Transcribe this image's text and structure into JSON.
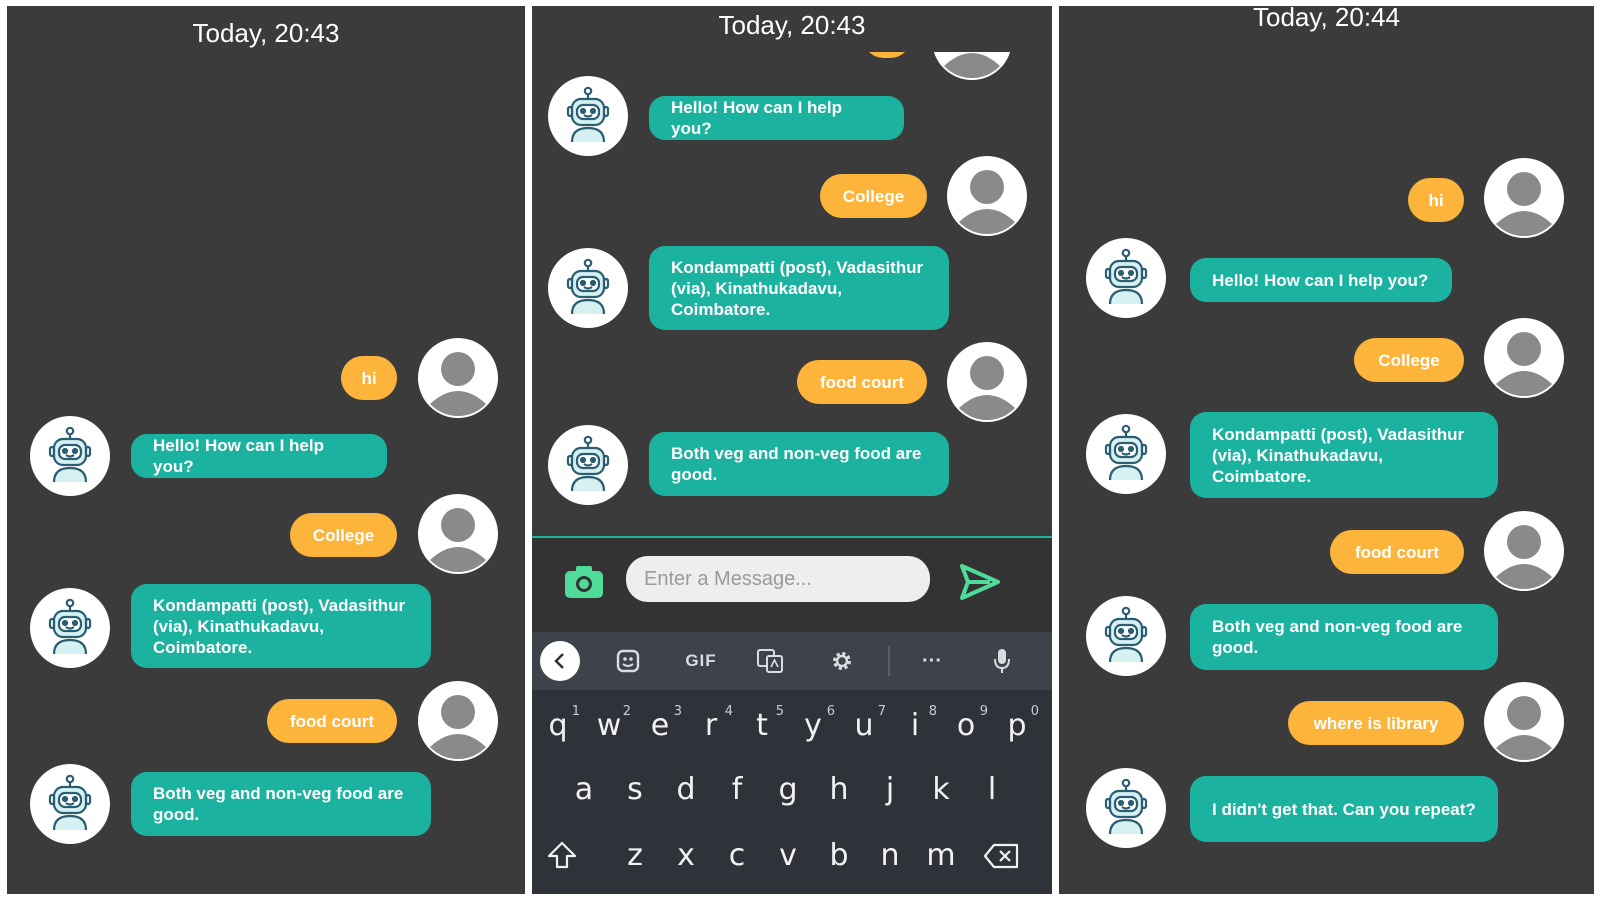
{
  "colors": {
    "panel_bg": "#3b3b3b",
    "bot_bubble": "#1bb3a0",
    "user_bubble": "#fcb43a",
    "accent": "#4fdc9a"
  },
  "icons": {
    "bot": "robot-avatar-icon",
    "user": "person-avatar-icon",
    "camera": "camera-icon",
    "send": "send-arrow-icon"
  },
  "panel1": {
    "time": "Today, 20:43",
    "messages": [
      {
        "from": "user",
        "text": "hi"
      },
      {
        "from": "bot",
        "text": "Hello! How can I help you?"
      },
      {
        "from": "user",
        "text": "College"
      },
      {
        "from": "bot",
        "text": "Kondampatti (post), Vadasithur (via), Kinathukadavu, Coimbatore."
      },
      {
        "from": "user",
        "text": "food court"
      },
      {
        "from": "bot",
        "text": "Both veg and non-veg food are good."
      }
    ]
  },
  "panel2": {
    "time": "Today, 20:43",
    "messages": [
      {
        "from": "bot",
        "text": "Hello! How can I help you?"
      },
      {
        "from": "user",
        "text": "College"
      },
      {
        "from": "bot",
        "text": "Kondampatti (post), Vadasithur (via), Kinathukadavu, Coimbatore."
      },
      {
        "from": "user",
        "text": "food court"
      },
      {
        "from": "bot",
        "text": "Both veg and non-veg food are good."
      }
    ],
    "input": {
      "placeholder": "Enter a Message..."
    },
    "keyboard": {
      "toolbar": {
        "gif": "GIF",
        "more": "···"
      },
      "row1": [
        {
          "k": "q",
          "n": "1"
        },
        {
          "k": "w",
          "n": "2"
        },
        {
          "k": "e",
          "n": "3"
        },
        {
          "k": "r",
          "n": "4"
        },
        {
          "k": "t",
          "n": "5"
        },
        {
          "k": "y",
          "n": "6"
        },
        {
          "k": "u",
          "n": "7"
        },
        {
          "k": "i",
          "n": "8"
        },
        {
          "k": "o",
          "n": "9"
        },
        {
          "k": "p",
          "n": "0"
        }
      ],
      "row2": [
        "a",
        "s",
        "d",
        "f",
        "g",
        "h",
        "j",
        "k",
        "l"
      ],
      "row3": [
        "z",
        "x",
        "c",
        "v",
        "b",
        "n",
        "m"
      ]
    }
  },
  "panel3": {
    "time": "Today, 20:44",
    "messages": [
      {
        "from": "user",
        "text": "hi"
      },
      {
        "from": "bot",
        "text": "Hello! How can I help you?"
      },
      {
        "from": "user",
        "text": "College"
      },
      {
        "from": "bot",
        "text": "Kondampatti (post), Vadasithur (via), Kinathukadavu, Coimbatore."
      },
      {
        "from": "user",
        "text": "food court"
      },
      {
        "from": "bot",
        "text": "Both veg and non-veg food are good."
      },
      {
        "from": "user",
        "text": "where is library"
      },
      {
        "from": "bot",
        "text": "I didn't get that. Can you repeat?"
      }
    ]
  }
}
